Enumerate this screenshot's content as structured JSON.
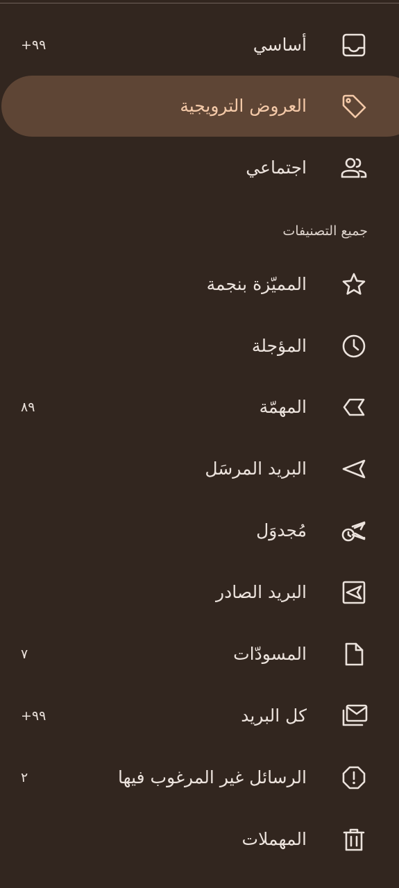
{
  "primary": [
    {
      "label": "أساسي",
      "count": "+۹۹",
      "icon": "inbox-icon"
    },
    {
      "label": "العروض الترويجية",
      "count": "",
      "icon": "tag-icon",
      "selected": true
    },
    {
      "label": "اجتماعي",
      "count": "",
      "icon": "people-icon"
    }
  ],
  "section_header": "جميع التصنيفات",
  "folders": [
    {
      "label": "المميّزة بنجمة",
      "count": "",
      "icon": "star-icon"
    },
    {
      "label": "المؤجلة",
      "count": "",
      "icon": "clock-icon"
    },
    {
      "label": "المهمّة",
      "count": "۸۹",
      "icon": "important-icon"
    },
    {
      "label": "البريد المرسَل",
      "count": "",
      "icon": "send-icon"
    },
    {
      "label": "مُجدوَل",
      "count": "",
      "icon": "scheduled-send-icon"
    },
    {
      "label": "البريد الصادر",
      "count": "",
      "icon": "outbox-icon"
    },
    {
      "label": "المسودّات",
      "count": "۷",
      "icon": "draft-icon"
    },
    {
      "label": "كل البريد",
      "count": "+۹۹",
      "icon": "all-mail-icon"
    },
    {
      "label": "الرسائل غير المرغوب فيها",
      "count": "۲",
      "icon": "spam-icon"
    },
    {
      "label": "المهملات",
      "count": "",
      "icon": "trash-icon"
    }
  ],
  "colors": {
    "background": "#32261f",
    "selected_pill": "#5e4535",
    "selected_text": "#f4c9a8",
    "text": "#ece3dd"
  }
}
